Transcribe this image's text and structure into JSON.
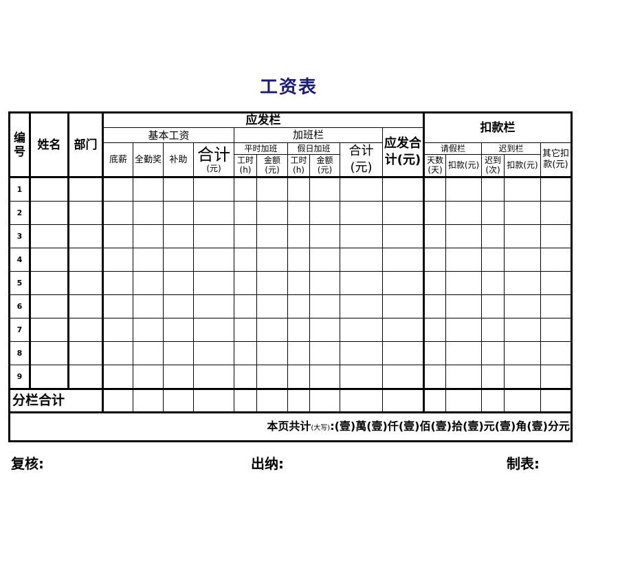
{
  "title": "工资表",
  "header": {
    "id": "编号",
    "name": "姓名",
    "dept": "部门",
    "payable": "应发栏",
    "basic": "基本工资",
    "base_salary": "底薪",
    "attendance": "全勤奖",
    "allowance": "补助",
    "basic_total": "合计",
    "basic_total_unit": "(元)",
    "overtime": "加班栏",
    "weekday_ot": "平时加班",
    "holiday_ot": "假日加班",
    "hours": "工时(h)",
    "amount": "金额(元)",
    "ot_total": "合计(元)",
    "payable_total": "应发合计(元)",
    "deduction": "扣款栏",
    "leave": "请假栏",
    "late": "迟到栏",
    "other": "其它扣款(元)",
    "days": "天数(天)",
    "leave_deduct": "扣款(元)",
    "late_count": "迟到(次)",
    "late_deduct": "扣款(元)"
  },
  "rows": [
    "1",
    "2",
    "3",
    "4",
    "5",
    "6",
    "7",
    "8",
    "9"
  ],
  "subtotal_label": "分栏合计",
  "total": {
    "prefix": "本页共计",
    "hint": "(大写)",
    "text": ":(壹)萬(壹)仟(壹)佰(壹)拾(壹)元(壹)角(壹)分元"
  },
  "signatures": {
    "review": "复核:",
    "cashier": "出纳:",
    "prepared": "制表:"
  }
}
